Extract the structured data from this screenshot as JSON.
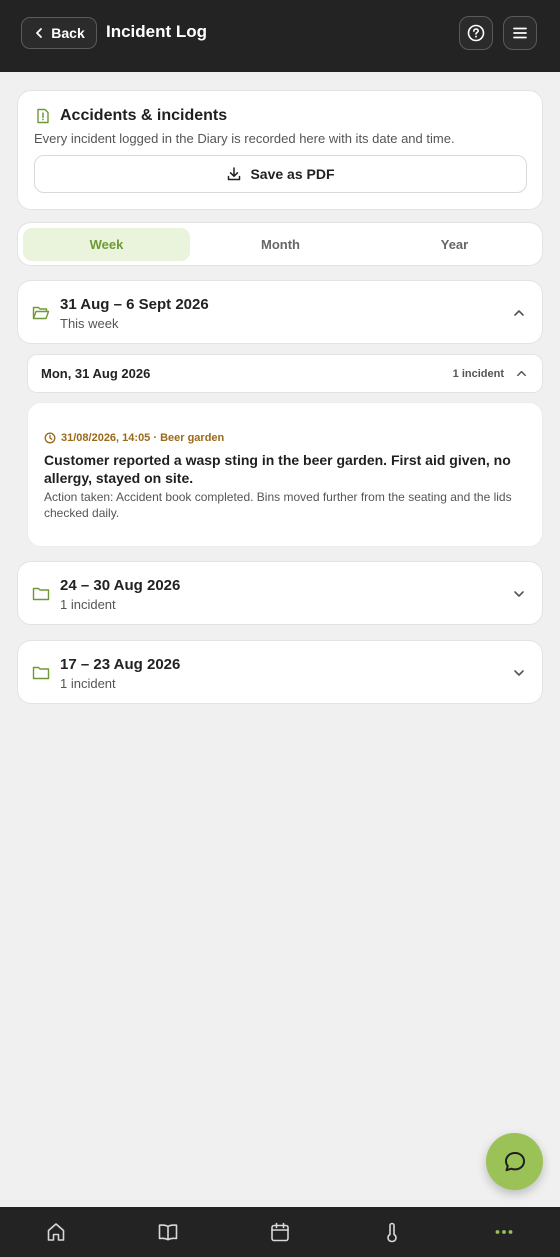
{
  "header": {
    "back_label": "Back",
    "title": "Incident Log",
    "help_icon": "question-circle-icon",
    "menu_icon": "hamburger-menu-icon"
  },
  "summary": {
    "title": "Accidents & incidents",
    "description": "Every incident logged in the Diary is recorded here with its date and time.",
    "pdf_button_label": "Save as PDF"
  },
  "tabs": [
    {
      "label": "Week",
      "active": true
    },
    {
      "label": "Month",
      "active": false
    },
    {
      "label": "Year",
      "active": false
    }
  ],
  "weeks": [
    {
      "title": "31 Aug – 6 Sept 2026",
      "subtitle": "This week",
      "expanded": true,
      "day": {
        "title": "Mon, 31 Aug 2026",
        "count": "1 incident",
        "incident": {
          "meta": "31/08/2026, 14:05 · Beer garden",
          "title": "Customer reported a wasp sting in the beer garden. First aid given, no allergy, stayed on site.",
          "action": "Action taken: Accident book completed. Bins moved further from the seating and the lids checked daily."
        }
      }
    },
    {
      "title": "24 – 30 Aug 2026",
      "subtitle": "1 incident",
      "expanded": false
    },
    {
      "title": "17 – 23 Aug 2026",
      "subtitle": "1 incident",
      "expanded": false
    }
  ],
  "bottom_nav": [
    "home-icon",
    "book-icon",
    "calendar-icon",
    "thermometer-icon",
    "more-icon"
  ],
  "colors": {
    "accent": "#9bc257",
    "accent_dark": "#6e9a35",
    "meta_text": "#9a6a1b",
    "bar_bg": "#232323",
    "page_bg": "#f0f0f0"
  }
}
